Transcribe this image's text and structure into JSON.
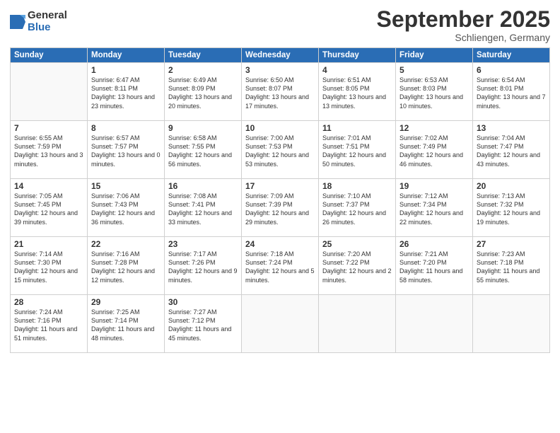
{
  "logo": {
    "general": "General",
    "blue": "Blue"
  },
  "header": {
    "month": "September 2025",
    "location": "Schliengen, Germany"
  },
  "weekdays": [
    "Sunday",
    "Monday",
    "Tuesday",
    "Wednesday",
    "Thursday",
    "Friday",
    "Saturday"
  ],
  "weeks": [
    [
      {
        "day": "",
        "info": ""
      },
      {
        "day": "1",
        "info": "Sunrise: 6:47 AM\nSunset: 8:11 PM\nDaylight: 13 hours\nand 23 minutes."
      },
      {
        "day": "2",
        "info": "Sunrise: 6:49 AM\nSunset: 8:09 PM\nDaylight: 13 hours\nand 20 minutes."
      },
      {
        "day": "3",
        "info": "Sunrise: 6:50 AM\nSunset: 8:07 PM\nDaylight: 13 hours\nand 17 minutes."
      },
      {
        "day": "4",
        "info": "Sunrise: 6:51 AM\nSunset: 8:05 PM\nDaylight: 13 hours\nand 13 minutes."
      },
      {
        "day": "5",
        "info": "Sunrise: 6:53 AM\nSunset: 8:03 PM\nDaylight: 13 hours\nand 10 minutes."
      },
      {
        "day": "6",
        "info": "Sunrise: 6:54 AM\nSunset: 8:01 PM\nDaylight: 13 hours\nand 7 minutes."
      }
    ],
    [
      {
        "day": "7",
        "info": "Sunrise: 6:55 AM\nSunset: 7:59 PM\nDaylight: 13 hours\nand 3 minutes."
      },
      {
        "day": "8",
        "info": "Sunrise: 6:57 AM\nSunset: 7:57 PM\nDaylight: 13 hours\nand 0 minutes."
      },
      {
        "day": "9",
        "info": "Sunrise: 6:58 AM\nSunset: 7:55 PM\nDaylight: 12 hours\nand 56 minutes."
      },
      {
        "day": "10",
        "info": "Sunrise: 7:00 AM\nSunset: 7:53 PM\nDaylight: 12 hours\nand 53 minutes."
      },
      {
        "day": "11",
        "info": "Sunrise: 7:01 AM\nSunset: 7:51 PM\nDaylight: 12 hours\nand 50 minutes."
      },
      {
        "day": "12",
        "info": "Sunrise: 7:02 AM\nSunset: 7:49 PM\nDaylight: 12 hours\nand 46 minutes."
      },
      {
        "day": "13",
        "info": "Sunrise: 7:04 AM\nSunset: 7:47 PM\nDaylight: 12 hours\nand 43 minutes."
      }
    ],
    [
      {
        "day": "14",
        "info": "Sunrise: 7:05 AM\nSunset: 7:45 PM\nDaylight: 12 hours\nand 39 minutes."
      },
      {
        "day": "15",
        "info": "Sunrise: 7:06 AM\nSunset: 7:43 PM\nDaylight: 12 hours\nand 36 minutes."
      },
      {
        "day": "16",
        "info": "Sunrise: 7:08 AM\nSunset: 7:41 PM\nDaylight: 12 hours\nand 33 minutes."
      },
      {
        "day": "17",
        "info": "Sunrise: 7:09 AM\nSunset: 7:39 PM\nDaylight: 12 hours\nand 29 minutes."
      },
      {
        "day": "18",
        "info": "Sunrise: 7:10 AM\nSunset: 7:37 PM\nDaylight: 12 hours\nand 26 minutes."
      },
      {
        "day": "19",
        "info": "Sunrise: 7:12 AM\nSunset: 7:34 PM\nDaylight: 12 hours\nand 22 minutes."
      },
      {
        "day": "20",
        "info": "Sunrise: 7:13 AM\nSunset: 7:32 PM\nDaylight: 12 hours\nand 19 minutes."
      }
    ],
    [
      {
        "day": "21",
        "info": "Sunrise: 7:14 AM\nSunset: 7:30 PM\nDaylight: 12 hours\nand 15 minutes."
      },
      {
        "day": "22",
        "info": "Sunrise: 7:16 AM\nSunset: 7:28 PM\nDaylight: 12 hours\nand 12 minutes."
      },
      {
        "day": "23",
        "info": "Sunrise: 7:17 AM\nSunset: 7:26 PM\nDaylight: 12 hours\nand 9 minutes."
      },
      {
        "day": "24",
        "info": "Sunrise: 7:18 AM\nSunset: 7:24 PM\nDaylight: 12 hours\nand 5 minutes."
      },
      {
        "day": "25",
        "info": "Sunrise: 7:20 AM\nSunset: 7:22 PM\nDaylight: 12 hours\nand 2 minutes."
      },
      {
        "day": "26",
        "info": "Sunrise: 7:21 AM\nSunset: 7:20 PM\nDaylight: 11 hours\nand 58 minutes."
      },
      {
        "day": "27",
        "info": "Sunrise: 7:23 AM\nSunset: 7:18 PM\nDaylight: 11 hours\nand 55 minutes."
      }
    ],
    [
      {
        "day": "28",
        "info": "Sunrise: 7:24 AM\nSunset: 7:16 PM\nDaylight: 11 hours\nand 51 minutes."
      },
      {
        "day": "29",
        "info": "Sunrise: 7:25 AM\nSunset: 7:14 PM\nDaylight: 11 hours\nand 48 minutes."
      },
      {
        "day": "30",
        "info": "Sunrise: 7:27 AM\nSunset: 7:12 PM\nDaylight: 11 hours\nand 45 minutes."
      },
      {
        "day": "",
        "info": ""
      },
      {
        "day": "",
        "info": ""
      },
      {
        "day": "",
        "info": ""
      },
      {
        "day": "",
        "info": ""
      }
    ]
  ]
}
